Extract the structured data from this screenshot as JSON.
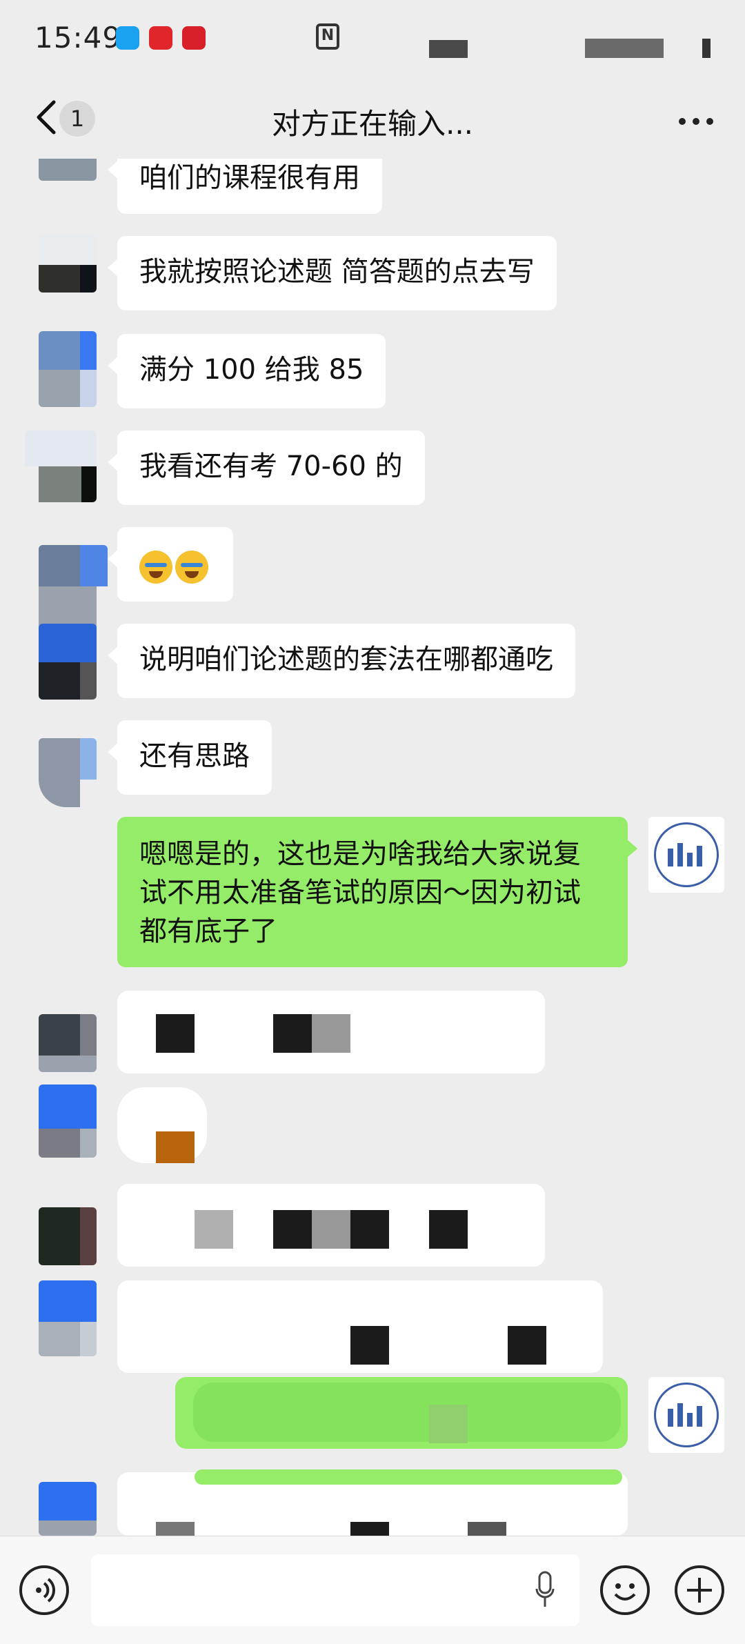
{
  "status_bar": {
    "time": "15:49",
    "nfc_label": "N"
  },
  "header": {
    "back_icon": "chevron-left-icon",
    "unread_count": "1",
    "title": "对方正在输入...",
    "more_icon": "more-horizontal-icon"
  },
  "messages": [
    {
      "side": "left",
      "text": "咱们的课程很有用"
    },
    {
      "side": "left",
      "text": "我就按照论述题 简答题的点去写"
    },
    {
      "side": "left",
      "text": "满分 100 给我 85"
    },
    {
      "side": "left",
      "text": "我看还有考 70-60 的"
    },
    {
      "side": "left",
      "emoji": "crying-laughing-emoji x2"
    },
    {
      "side": "left",
      "text": "说明咱们论述题的套法在哪都通吃"
    },
    {
      "side": "left",
      "text": "还有思路"
    },
    {
      "side": "right",
      "text": "嗯嗯是的，这也是为啥我给大家说复试不用太准备笔试的原因～因为初试都有底子了"
    }
  ],
  "colors": {
    "background": "#ededed",
    "incoming_bubble": "#ffffff",
    "outgoing_bubble": "#95ec69"
  },
  "input_bar": {
    "voice_icon": "voice-icon",
    "mic_icon": "microphone-icon",
    "emoji_icon": "emoji-icon",
    "plus_icon": "plus-icon"
  }
}
